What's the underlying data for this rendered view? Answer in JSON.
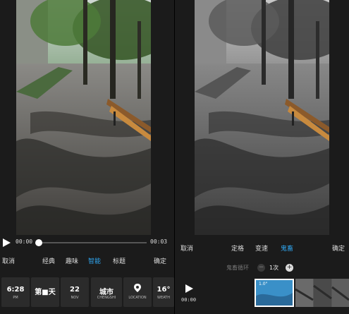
{
  "left": {
    "time_start": "00:00",
    "time_end": "00:03",
    "progress": 0.0,
    "cancel": "取消",
    "confirm": "确定",
    "tabs": [
      "经典",
      "趣味",
      "智能",
      "标题"
    ],
    "active_tab": "智能",
    "tiles": [
      {
        "big": "6:28",
        "small": "PM"
      },
      {
        "big": "第■天",
        "small": ""
      },
      {
        "big": "22",
        "small": "NOV"
      },
      {
        "big": "城市",
        "small": "CHENGSHI"
      },
      {
        "big": "",
        "small": "LOCATION"
      },
      {
        "big": "16°",
        "small": "WEATH"
      }
    ]
  },
  "right": {
    "cancel": "取消",
    "confirm": "确定",
    "tabs": [
      "定格",
      "变速",
      "鬼畜"
    ],
    "active_tab": "鬼畜",
    "loop_label": "鬼畜循环",
    "loop_count": "1次",
    "time": "00:00",
    "frame_label": "1.0\""
  },
  "colors": {
    "accent": "#2fa6f0",
    "background": "#1b1b1b"
  }
}
